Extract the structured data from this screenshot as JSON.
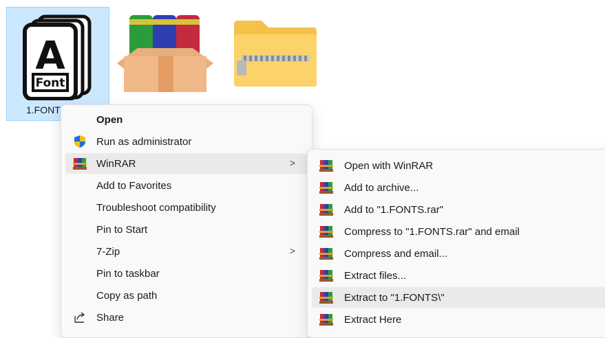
{
  "desktop": {
    "icons": [
      {
        "name": "font-file-icon",
        "label": "1.FONT"
      },
      {
        "name": "winrar-archive-icon",
        "label": ""
      },
      {
        "name": "zip-folder-icon",
        "label": ""
      }
    ],
    "font_glyph_text": "Font",
    "font_glyph_letter": "A"
  },
  "context_menu": {
    "items": [
      {
        "label": "Open",
        "bold": true
      },
      {
        "label": "Run as administrator",
        "icon": "uac-shield-icon"
      },
      {
        "label": "WinRAR",
        "icon": "winrar-icon",
        "has_submenu": true,
        "highlighted": true
      },
      {
        "label": "Add to Favorites"
      },
      {
        "label": "Troubleshoot compatibility"
      },
      {
        "label": "Pin to Start"
      },
      {
        "label": "7-Zip",
        "has_submenu": true
      },
      {
        "label": "Pin to taskbar"
      },
      {
        "label": "Copy as path"
      },
      {
        "label": "Share",
        "icon": "share-icon"
      }
    ],
    "chevron": ">"
  },
  "winrar_submenu": {
    "items": [
      {
        "label": "Open with WinRAR"
      },
      {
        "label": "Add to archive..."
      },
      {
        "label": "Add to \"1.FONTS.rar\""
      },
      {
        "label": "Compress to \"1.FONTS.rar\" and email"
      },
      {
        "label": "Compress and email..."
      },
      {
        "label": "Extract files..."
      },
      {
        "label": "Extract to \"1.FONTS\\\"",
        "highlighted": true
      },
      {
        "label": "Extract Here"
      }
    ]
  },
  "colors": {
    "selection": "#cce8ff",
    "menu_bg": "#f9f9f9",
    "highlight": "#eaeaea"
  }
}
